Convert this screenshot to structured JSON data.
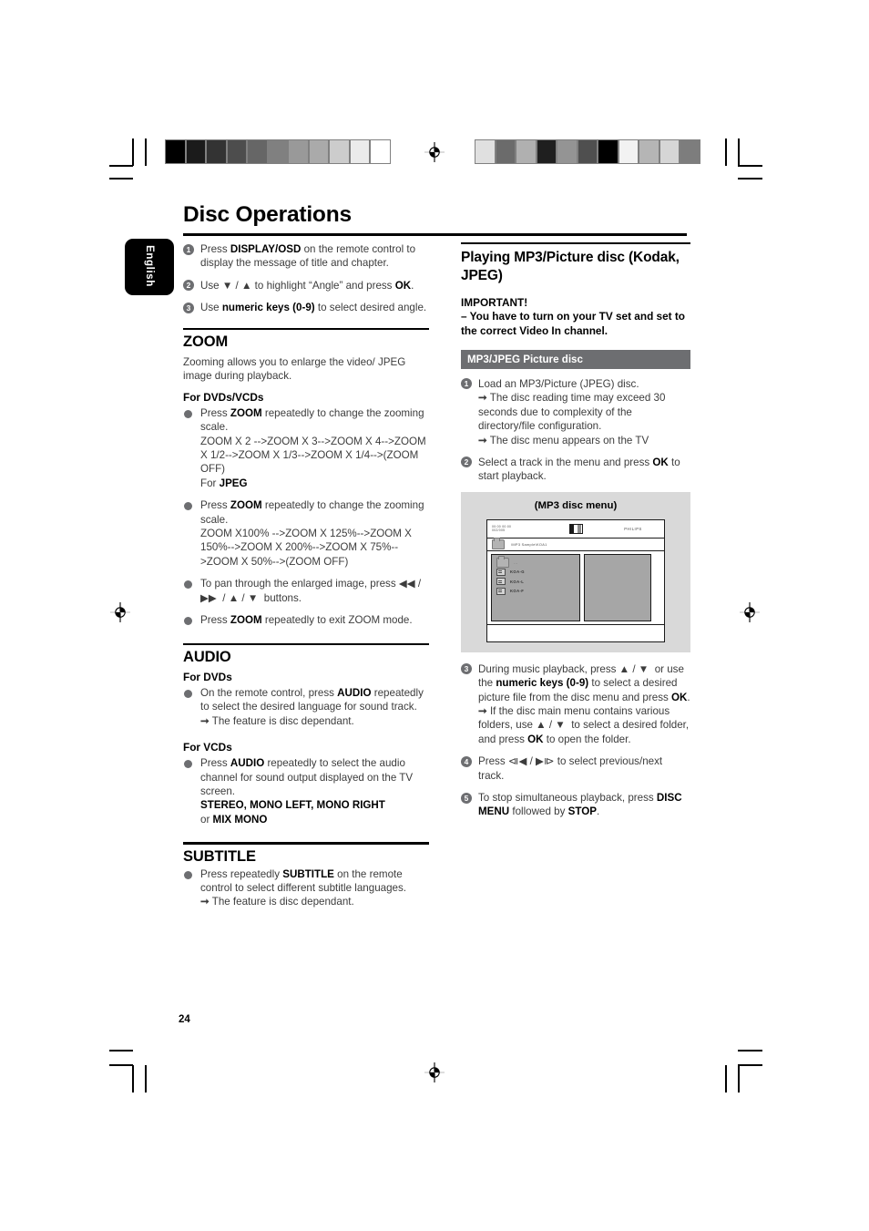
{
  "page": {
    "title": "Disc Operations",
    "language_tab": "English",
    "page_number": "24"
  },
  "calibration": {
    "left_bar": [
      "#000000",
      "#1b1b1b",
      "#333333",
      "#4d4d4d",
      "#666666",
      "#808080",
      "#999999",
      "#aaaaaa",
      "#cccccc",
      "#ebebeb",
      "#ffffff"
    ],
    "right_bar": [
      "#e0e0e0",
      "#6b6b6b",
      "#b0b0b0",
      "#1f1f1f",
      "#949494",
      "#4f4f4f",
      "#000000",
      "#f2f2f2",
      "#b5b5b5",
      "#d6d6d6",
      "#7d7d7d"
    ]
  },
  "left_column": {
    "steps": [
      {
        "num": "1",
        "html": "Press <b>DISPLAY/OSD</b> on the remote control to display the message of title and chapter."
      },
      {
        "num": "2",
        "html": "Use ▼ / ▲ to highlight “Angle” and press <b>OK</b>."
      },
      {
        "num": "3",
        "html": "Use <b>numeric keys (0-9)</b> to select desired angle."
      }
    ],
    "zoom": {
      "heading": "ZOOM",
      "intro": "Zooming allows you to enlarge the video/ JPEG image during playback.",
      "sub_dvd_vcd": "For DVDs/VCDs",
      "bullet_dvd_html": "Press <b>ZOOM</b> repeatedly to change the zooming scale.<br>ZOOM X 2 --&gt;ZOOM X 3--&gt;ZOOM X 4--&gt;ZOOM X 1/2--&gt;ZOOM X 1/3--&gt;ZOOM X 1/4--&gt;(ZOOM OFF)<br>For <b>JPEG</b>",
      "bullet_jpeg_html": "Press <b>ZOOM</b> repeatedly to change the zooming scale.<br>ZOOM X100% --&gt;ZOOM X 125%--&gt;ZOOM X 150%--&gt;ZOOM X 200%--&gt;ZOOM X 75%--&gt;ZOOM X 50%--&gt;(ZOOM OFF)",
      "bullet_pan_html": "To pan through the enlarged image, press ◀◀ /▶▶ &nbsp;/ ▲ / ▼ &nbsp;buttons.",
      "bullet_exit_html": "Press <b>ZOOM</b> repeatedly to exit ZOOM mode."
    },
    "audio": {
      "heading": "AUDIO",
      "sub_dvd": "For DVDs",
      "bullet_dvd_html": "On the remote control, press <b>AUDIO</b> repeatedly to select the desired language for sound track.",
      "note_dvd": "The feature is disc dependant.",
      "sub_vcd": "For VCDs",
      "bullet_vcd_html": "Press <b>AUDIO</b> repeatedly to select the audio channel for sound output displayed on the TV screen.<br><b>STEREO, MONO LEFT, MONO RIGHT</b><br>or <b>MIX MONO</b>"
    },
    "subtitle": {
      "heading": "SUBTITLE",
      "bullet_html": "Press repeatedly <b>SUBTITLE</b> on the remote control to select different subtitle languages.",
      "note": "The feature is disc dependant."
    }
  },
  "right_column": {
    "heading": "Playing MP3/Picture disc (Kodak, JPEG)",
    "important_label": "IMPORTANT!",
    "important_text": "–  You have to turn on your TV set and set to the correct Video In channel.",
    "section_bar": "MP3/JPEG Picture disc",
    "steps": [
      {
        "num": "1",
        "html": "Load an MP3/Picture (JPEG) disc.",
        "notes": [
          "The disc reading time may exceed 30 seconds due to complexity of the directory/file configuration.",
          "The disc menu appears on the TV"
        ]
      },
      {
        "num": "2",
        "html": "Select a track in the menu and press <b>OK</b> to start playback.",
        "notes": []
      },
      {
        "num": "3",
        "html": "During music playback, press ▲ / ▼ &nbsp;or use the <b>numeric keys (0-9)</b> to select a desired picture file from the disc menu and press <b>OK</b>.",
        "notes": [
          "If the disc main menu contains various folders, use ▲ / ▼ &nbsp;to select a desired folder, and press <b>OK</b> to open the folder."
        ]
      },
      {
        "num": "4",
        "html": "Press ⧏◀ / ▶⧐ to select previous/next track.",
        "notes": []
      },
      {
        "num": "5",
        "html": "To stop simultaneous playback, press <b>DISC MENU</b> followed by <b>STOP</b>.",
        "notes": []
      }
    ],
    "figure": {
      "caption": "(MP3 disc menu)",
      "screen": {
        "time_line1": "00:00   00:00",
        "time_line2": "002/005",
        "brand": "PHILIPS",
        "path": "\\MP3 Sample\\KOA1",
        "entries": [
          {
            "type": "folder",
            "label": "..."
          },
          {
            "type": "file",
            "label": "KOA-G"
          },
          {
            "type": "file",
            "label": "KOA-L"
          },
          {
            "type": "file",
            "label": "KOA-F"
          }
        ]
      }
    }
  }
}
